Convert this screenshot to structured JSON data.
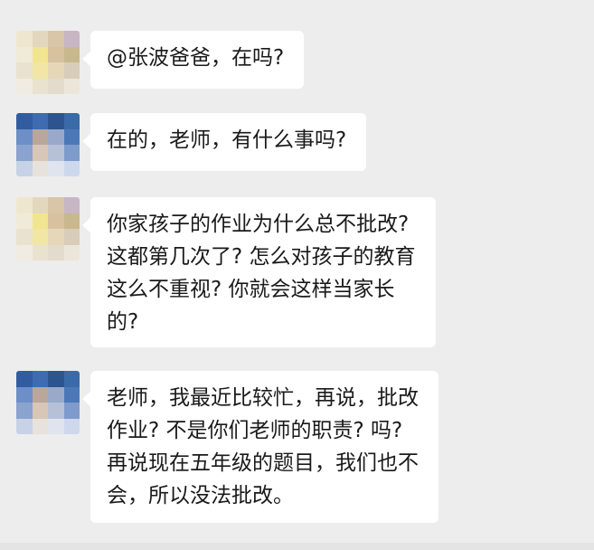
{
  "conversation": {
    "messages": [
      {
        "sender": "teacher",
        "lines": [
          "@张波爸爸，在吗?"
        ]
      },
      {
        "sender": "parent",
        "lines": [
          "在的，老师，有什么事吗?"
        ]
      },
      {
        "sender": "teacher",
        "lines": [
          "你家孩子的作业为什么总不批改?",
          "这都第几次了? 怎么对孩子的教育",
          "这么不重视? 你就会这样当家长",
          "的?"
        ]
      },
      {
        "sender": "parent",
        "lines": [
          "老师，我最近比较忙，再说，批改",
          "作业? 不是你们老师的职责? 吗?",
          "再说现在五年级的题目，我们也不",
          "会，所以没法批改。"
        ]
      }
    ]
  },
  "colors": {
    "background": "#ededed",
    "bubble": "#ffffff",
    "text": "#1a1a1a",
    "teacher_avatar_palette": [
      "#e9d8b6",
      "#f2ead0",
      "#cdbfa6",
      "#b9a3b6"
    ],
    "parent_avatar_palette": [
      "#2f4f86",
      "#6f8fc4",
      "#a8b9d6",
      "#e3d6c7"
    ]
  }
}
